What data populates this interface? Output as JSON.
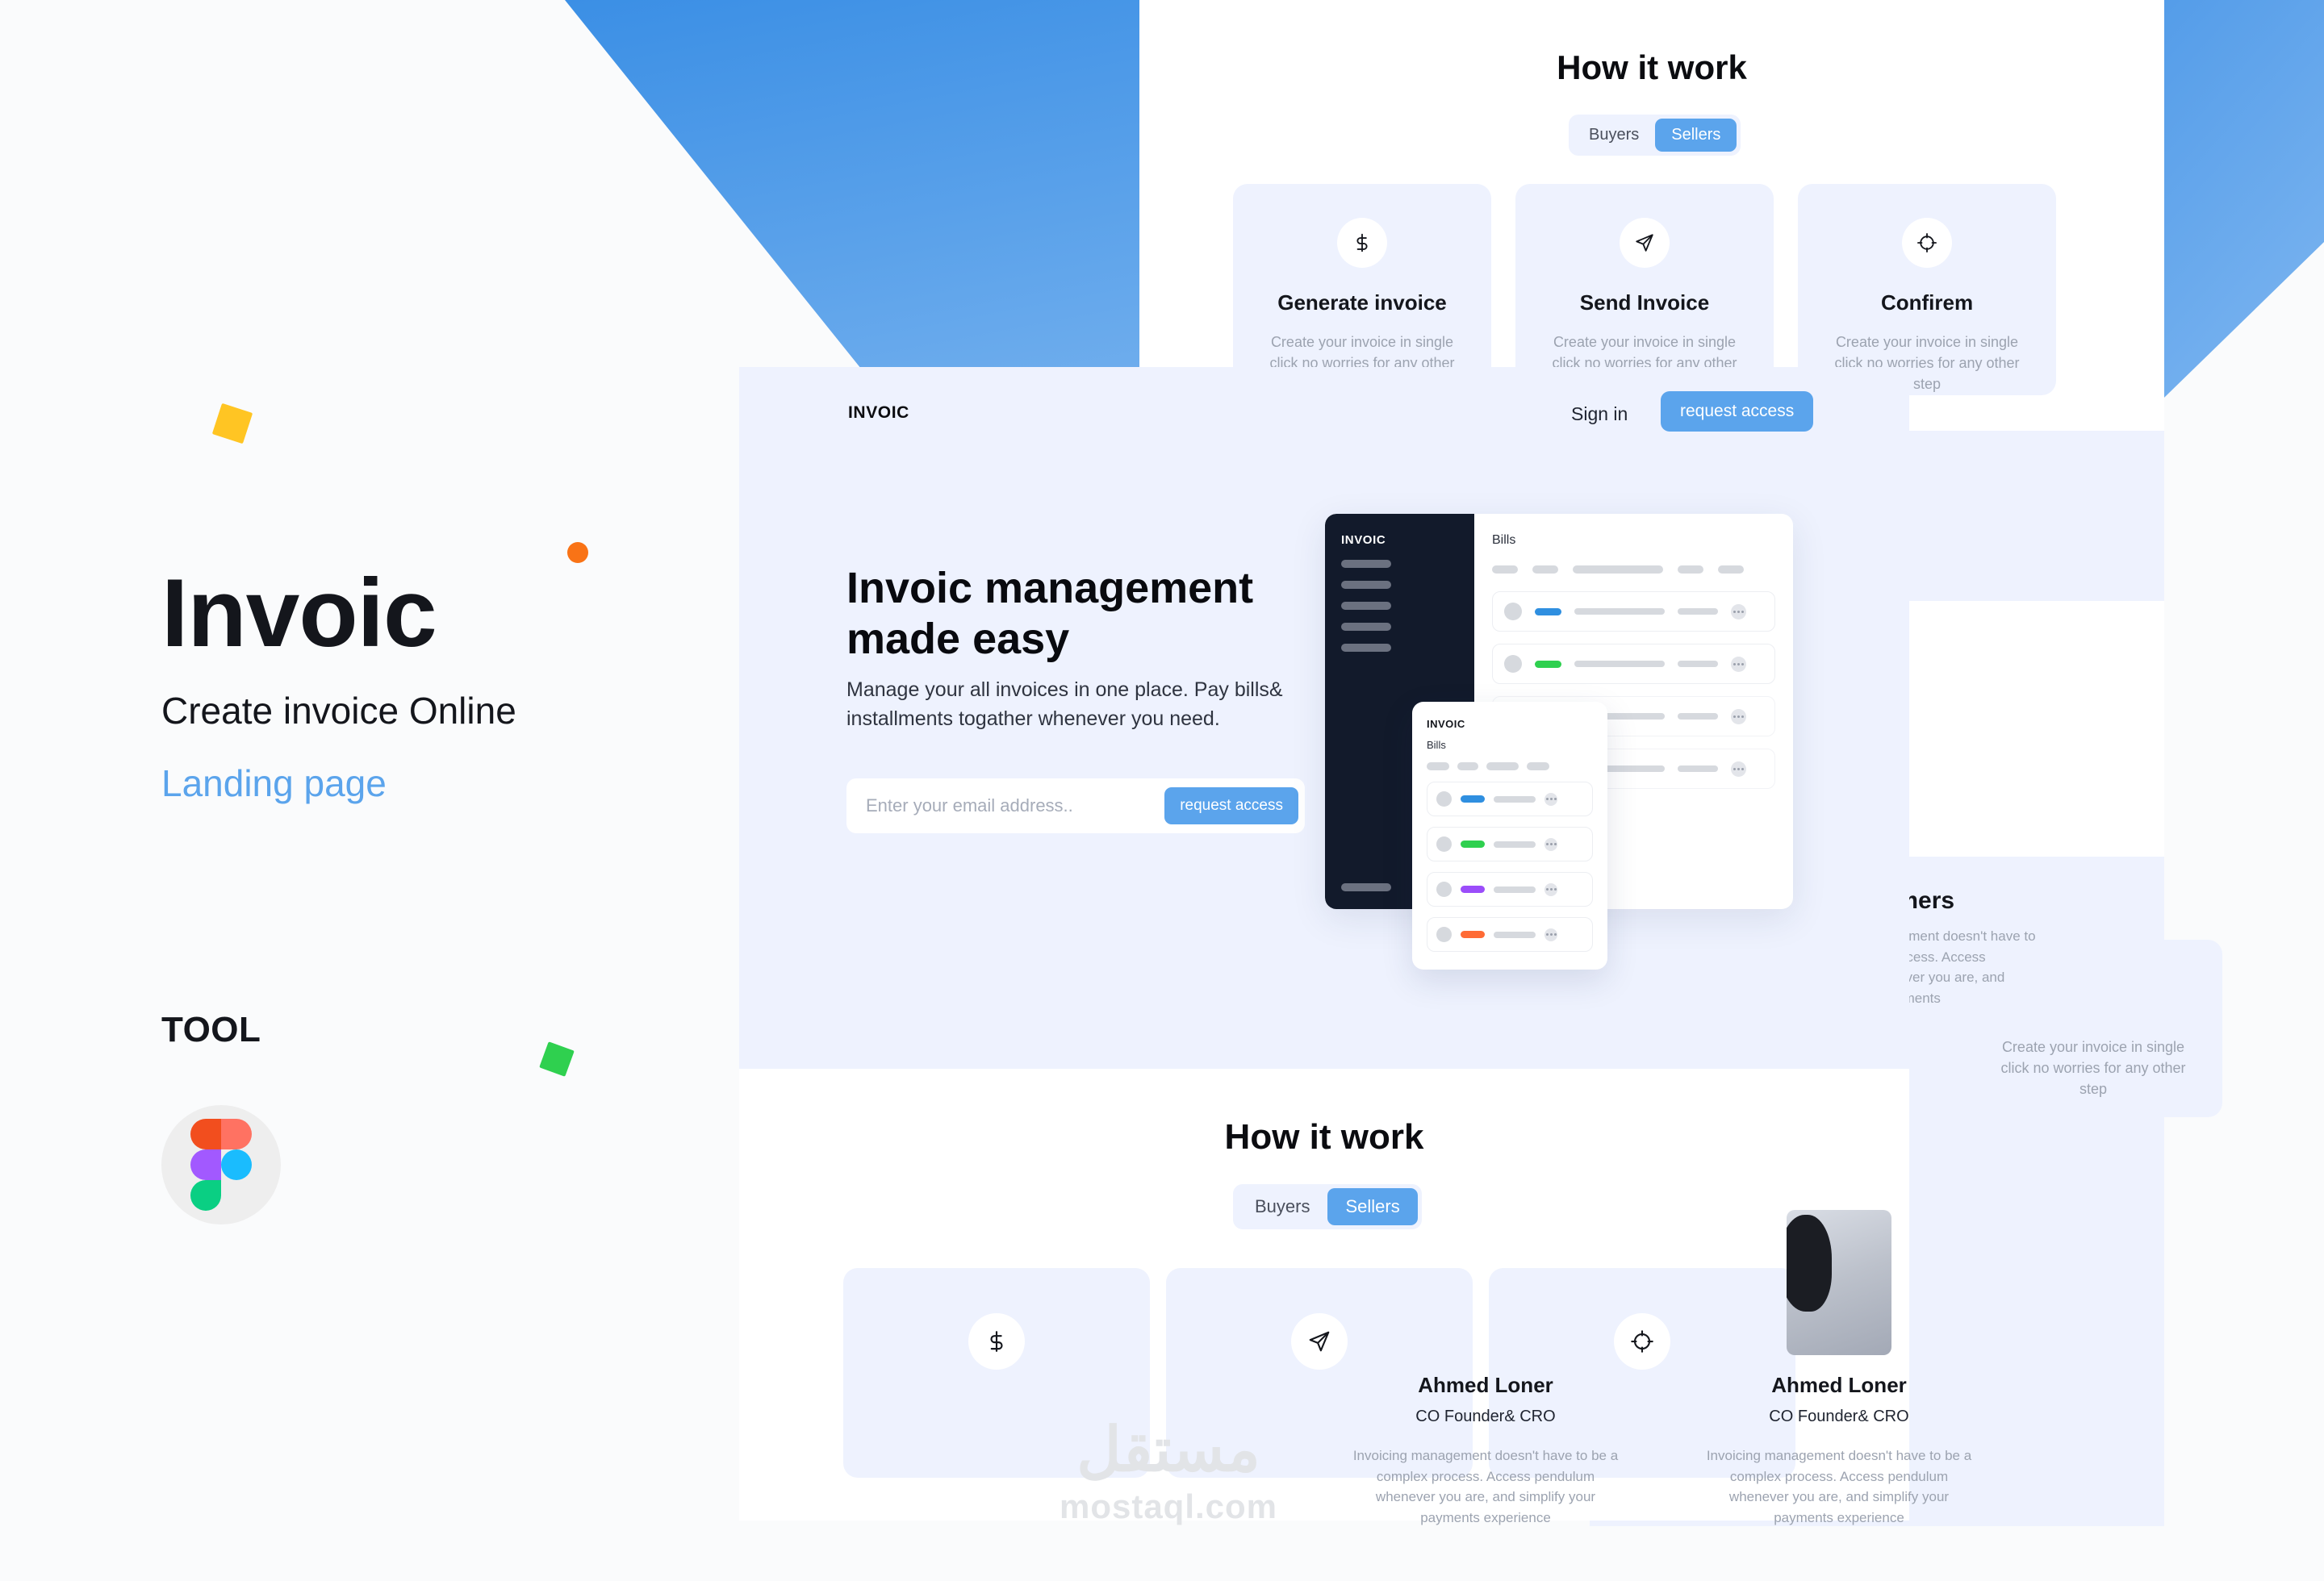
{
  "colors": {
    "brand_blue": "#5ba4ec",
    "accent_yellow": "#ffc523",
    "accent_orange": "#f97316",
    "accent_green": "#2fd04f",
    "lavender": "#eef2fe",
    "dark": "#121a2b"
  },
  "cover": {
    "title": "Invoic",
    "subtitle": "Create invoice Online",
    "kind": "Landing page",
    "tool_heading": "TOOL",
    "tool_name": "figma-logo"
  },
  "how_it_work_top": {
    "title": "How it work",
    "toggle": {
      "options": [
        "Buyers",
        "Sellers"
      ],
      "selected": "Sellers"
    },
    "steps": [
      {
        "icon": "dollar-icon",
        "glyph": "$",
        "name": "Generate invoice",
        "desc": "Create your invoice in single click no worries for any other step"
      },
      {
        "icon": "send-icon",
        "glyph": "send",
        "name": "Send Invoice",
        "desc": "Create your invoice in single click no worries for any other step"
      },
      {
        "icon": "target-icon",
        "glyph": "target",
        "name": "Confirem",
        "desc": "Create your invoice in single click no worries for any other step"
      }
    ]
  },
  "hero": {
    "logo": "INVOIC",
    "signin": "Sign in",
    "cta": "request access",
    "heading": "Invoic management made easy",
    "paragraph": "Manage your all invoices in one place. Pay bills& installments togather whenever you need.",
    "email_placeholder": "Enter your email address..",
    "email_value": "",
    "form_button": "request access"
  },
  "dashboard": {
    "sidebar_logo": "INVOIC",
    "table_title": "Bills",
    "rows": [
      {
        "status_color": "#2f8fe0"
      },
      {
        "status_color": "#2fd04f"
      },
      {
        "status_color": "#d6d9de"
      },
      {
        "status_color": "#d6d9de"
      }
    ],
    "float_card": {
      "logo": "INVOIC",
      "title": "Bills",
      "rows": [
        {
          "status_color": "#2f8fe0"
        },
        {
          "status_color": "#2fd04f"
        },
        {
          "status_color": "#9b4dfa"
        },
        {
          "status_color": "#ff6b35"
        }
      ]
    }
  },
  "costmers": {
    "title": "our costmers",
    "desc": "Invoicing management doesn't have to be a complex process. Access pendulum whenever you are, and simplify your payments"
  },
  "how_it_work_bottom": {
    "title": "How it work",
    "toggle": {
      "options": [
        "Buyers",
        "Sellers"
      ],
      "selected": "Sellers"
    },
    "steps": [
      {
        "icon": "dollar-icon",
        "glyph": "$"
      },
      {
        "icon": "send-icon",
        "glyph": "send"
      },
      {
        "icon": "target-icon",
        "glyph": "target"
      }
    ]
  },
  "testimonials": [
    {
      "name": "Ahmed Loner",
      "role": "CO Founder& CRO",
      "text": "Invoicing management doesn't have to be a complex process. Access pendulum whenever you are, and simplify your payments experience"
    },
    {
      "name": "Ahmed Loner",
      "role": "CO Founder& CRO",
      "text": "Invoicing management doesn't have to be a complex process. Access pendulum whenever you are, and simplify your payments experience"
    }
  ],
  "watermark": {
    "arabic": "مستقل",
    "latin": "mostaql.com"
  }
}
